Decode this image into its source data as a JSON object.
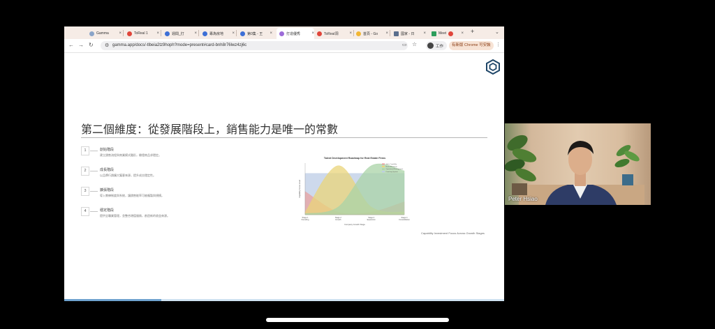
{
  "browser": {
    "tabs": [
      {
        "title": "Gamma"
      },
      {
        "title": "ToReal 1"
      },
      {
        "title": "週間_打"
      },
      {
        "title": "專為房地"
      },
      {
        "title": "第0集 - 王"
      },
      {
        "title": "打造優秀"
      },
      {
        "title": "ToReal洞"
      },
      {
        "title": "首頁 - Go"
      },
      {
        "title": "國家 - 日"
      },
      {
        "title": "Meet"
      }
    ],
    "active_tab_index": 5,
    "new_tab_label": "+",
    "url": "gamma.app/docs/-tlbeia2tz9hoph?mode=present#card-bnh8r76lwz4zj6c",
    "profile_label": "工作",
    "update_label": "有新版 Chrome 可安裝"
  },
  "slide": {
    "title": "第二個維度：從發展階段上，銷售能力是唯一的常數",
    "stages": [
      {
        "number": "1",
        "name": "創始階段",
        "desc": "建立銷售流程與商業模式雛形，驗證商品求穩定。"
      },
      {
        "number": "2",
        "name": "成長階段",
        "desc": "以品牌行銷擴大獲客來源，提升成交穩定性。"
      },
      {
        "number": "3",
        "name": "擴張階段",
        "desc": "導入教練制度與系統，讓銷售能率可被複製與規模。"
      },
      {
        "number": "4",
        "name": "穩定階段",
        "desc": "提供全職業管理，並整合增值服務，創造新的收益來源。"
      }
    ],
    "caption": "Capability Investment Focus Across Growth Stages",
    "progress_fraction": 0.22
  },
  "chart_data": {
    "type": "area",
    "title": "Talent Development Roadmap for Real Estate Firms",
    "xlabel": "Company Growth Stage",
    "ylabel": "Capability Focus Level",
    "categories": [
      "Stage 1 Founding",
      "Stage 2 Growth",
      "Stage 3 Expansion",
      "Stage 4 Consolidation"
    ],
    "series": [
      {
        "name": "Sales Capability",
        "color": "#e8a0a0",
        "values": [
          0.45,
          0.05,
          0.05,
          0.25
        ]
      },
      {
        "name": "Brand Marketing",
        "color": "#ead47a",
        "values": [
          0.05,
          0.95,
          0.15,
          0.05
        ]
      },
      {
        "name": "Operational Management",
        "color": "#a9d3a7",
        "values": [
          0.02,
          0.15,
          0.95,
          0.85
        ]
      },
      {
        "name": "Coaching System",
        "color": "#bccce6",
        "values": [
          0.8,
          0.8,
          0.8,
          0.8
        ]
      }
    ],
    "ylim": [
      0,
      1
    ],
    "grid": false,
    "legend": "top-right"
  },
  "webcam": {
    "name": "Peter Hsiao"
  }
}
